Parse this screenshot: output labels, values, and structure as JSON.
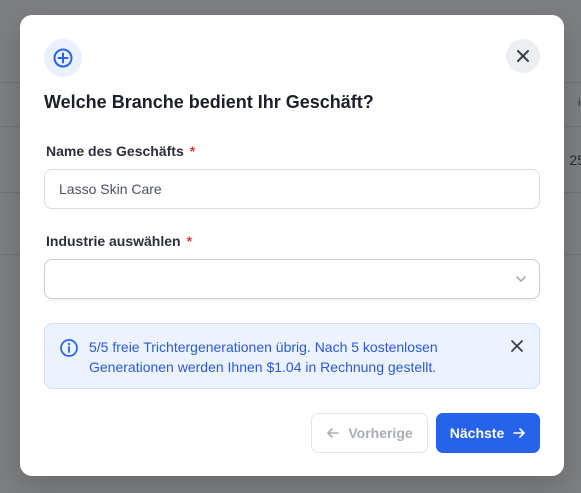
{
  "background": {
    "partial_header_text": "ialis",
    "partial_row_text": "25"
  },
  "modal": {
    "title": "Welche Branche bedient Ihr Geschäft?",
    "header_icon": "plus-circle-icon",
    "close_icon": "close-icon",
    "business_name": {
      "label": "Name des Geschäfts",
      "required_marker": "*",
      "value": "Lasso Skin Care"
    },
    "industry": {
      "label": "Industrie auswählen",
      "required_marker": "*",
      "selected": ""
    },
    "alert": {
      "icon": "info-icon",
      "message": "5/5 freie Trichtergenerationen übrig. Nach 5 kostenlosen Generationen werden Ihnen $1.04 in Rechnung gestellt."
    },
    "buttons": {
      "previous": "Vorherige",
      "next": "Nächste"
    }
  },
  "colors": {
    "primary": "#2563eb",
    "required": "#e23a3a",
    "alert_bg": "#ecf3fe",
    "alert_text": "#2a5bd7"
  }
}
